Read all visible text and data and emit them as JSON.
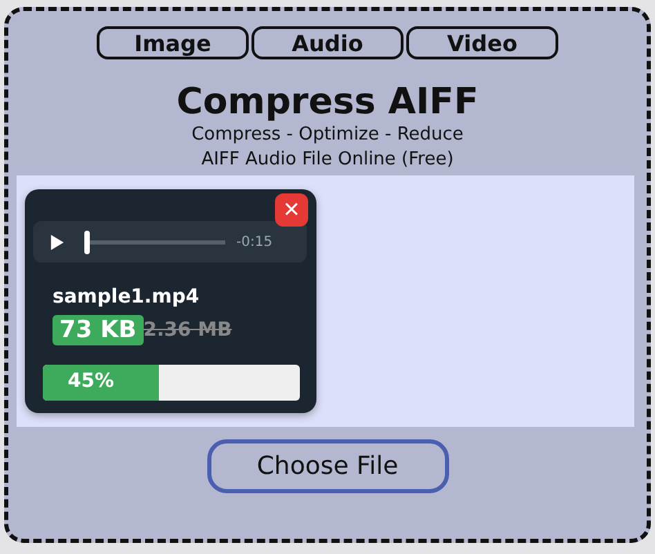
{
  "tabs": [
    {
      "label": "Image",
      "selected": false
    },
    {
      "label": "Audio",
      "selected": false
    },
    {
      "label": "Video",
      "selected": false
    }
  ],
  "title": "Compress AIFF",
  "subtitle": [
    "Compress - Optimize - Reduce",
    "AIFF Audio File Online (Free)"
  ],
  "file_card": {
    "close": "×",
    "player": {
      "level": 0.0,
      "time": "-0:15"
    },
    "file_name": "sample1.mp4",
    "new_size": "73 KB",
    "old_size": "2.36 MB",
    "progress": {
      "level": 0.45,
      "label": "45%"
    }
  },
  "choose_button": "Choose File"
}
